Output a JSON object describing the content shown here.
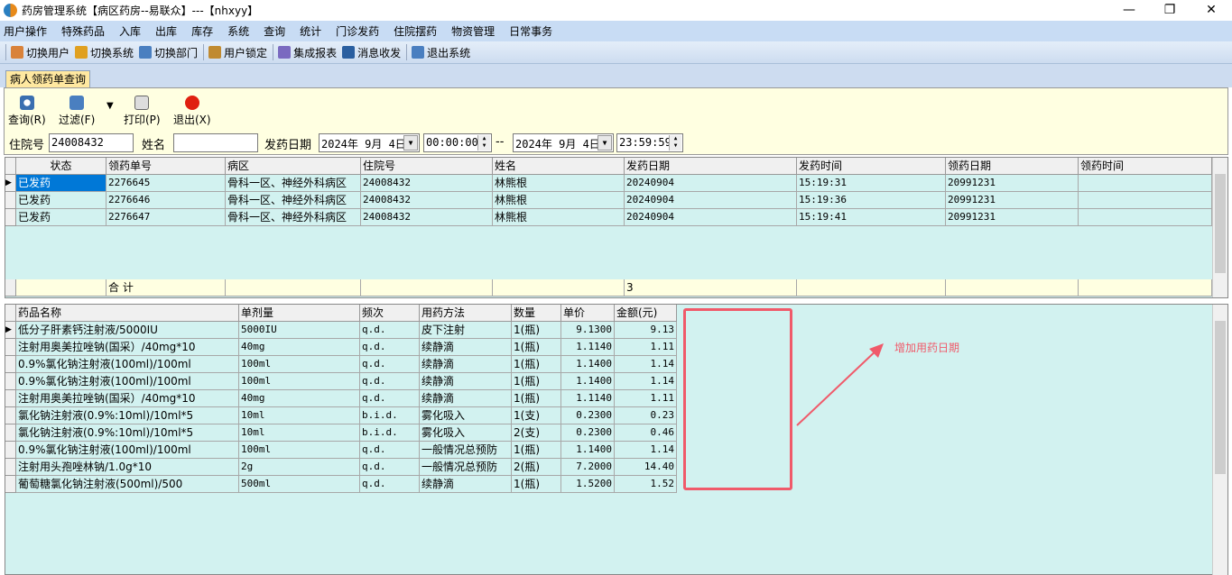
{
  "window": {
    "title": "药房管理系统【病区药房--易联众】---【nhxyy】",
    "minimize": "—",
    "maximize": "❐",
    "close": "✕"
  },
  "menu": [
    "用户操作",
    "特殊药品",
    "入库",
    "出库",
    "库存",
    "系统",
    "查询",
    "统计",
    "门诊发药",
    "住院摆药",
    "物资管理",
    "日常事务"
  ],
  "toolbar": [
    {
      "label": "切换用户",
      "icon": "switch-user-icon",
      "color": "#d9823a"
    },
    {
      "label": "切换系统",
      "icon": "switch-system-icon",
      "color": "#e0a020"
    },
    {
      "label": "切换部门",
      "icon": "switch-department-icon",
      "color": "#4a7fc0"
    },
    {
      "label": "用户锁定",
      "icon": "user-lock-icon",
      "color": "#c08a30"
    },
    {
      "label": "集成报表",
      "icon": "report-icon",
      "color": "#7a6ac0"
    },
    {
      "label": "消息收发",
      "icon": "message-icon",
      "color": "#2a5fa0"
    },
    {
      "label": "退出系统",
      "icon": "exit-system-icon",
      "color": "#4a7fc0"
    }
  ],
  "tab": "病人领药单查询",
  "actions": {
    "query": "查询(R)",
    "filter": "过滤(F)",
    "print": "打印(P)",
    "exit": "退出(X)"
  },
  "form": {
    "inpatient_label": "住院号",
    "inpatient_value": "24008432",
    "name_label": "姓名",
    "name_value": "",
    "date_label": "发药日期",
    "date_from": "2024年 9月 4日",
    "time_from": "00:00:00",
    "sep": "--",
    "date_to": "2024年 9月 4日",
    "time_to": "23:59:59"
  },
  "top_grid": {
    "columns": [
      "状态",
      "领药单号",
      "病区",
      "住院号",
      "姓名",
      "发药日期",
      "发药时间",
      "领药日期",
      "领药时间"
    ],
    "rows": [
      [
        "已发药",
        "2276645",
        "骨科一区、神经外科病区",
        "24008432",
        "林熊根",
        "20240904",
        "15:19:31",
        "20991231",
        ""
      ],
      [
        "已发药",
        "2276646",
        "骨科一区、神经外科病区",
        "24008432",
        "林熊根",
        "20240904",
        "15:19:36",
        "20991231",
        ""
      ],
      [
        "已发药",
        "2276647",
        "骨科一区、神经外科病区",
        "24008432",
        "林熊根",
        "20240904",
        "15:19:41",
        "20991231",
        ""
      ]
    ],
    "footer": {
      "label": "合 计",
      "count": "3"
    }
  },
  "bottom_grid": {
    "columns": [
      "药品名称",
      "单剂量",
      "频次",
      "用药方法",
      "数量",
      "单价",
      "金额(元)"
    ],
    "rows": [
      [
        "低分子肝素钙注射液/5000IU",
        "5000IU",
        "q.d.",
        "皮下注射",
        "1(瓶)",
        "9.1300",
        "9.13"
      ],
      [
        "注射用奥美拉唑钠(国采）/40mg*10",
        "40mg",
        "q.d.",
        "续静滴",
        "1(瓶)",
        "1.1140",
        "1.11"
      ],
      [
        "0.9%氯化钠注射液(100ml)/100ml",
        "100ml",
        "q.d.",
        "续静滴",
        "1(瓶)",
        "1.1400",
        "1.14"
      ],
      [
        "0.9%氯化钠注射液(100ml)/100ml",
        "100ml",
        "q.d.",
        "续静滴",
        "1(瓶)",
        "1.1400",
        "1.14"
      ],
      [
        "注射用奥美拉唑钠(国采）/40mg*10",
        "40mg",
        "q.d.",
        "续静滴",
        "1(瓶)",
        "1.1140",
        "1.11"
      ],
      [
        "氯化钠注射液(0.9%:10ml)/10ml*5",
        "10ml",
        "b.i.d.",
        "雾化吸入",
        "1(支)",
        "0.2300",
        "0.23"
      ],
      [
        "氯化钠注射液(0.9%:10ml)/10ml*5",
        "10ml",
        "b.i.d.",
        "雾化吸入",
        "2(支)",
        "0.2300",
        "0.46"
      ],
      [
        "0.9%氯化钠注射液(100ml)/100ml",
        "100ml",
        "q.d.",
        "一般情况总预防",
        "1(瓶)",
        "1.1400",
        "1.14"
      ],
      [
        "注射用头孢唑林钠/1.0g*10",
        "2g",
        "q.d.",
        "一般情况总预防",
        "2(瓶)",
        "7.2000",
        "14.40"
      ],
      [
        "葡萄糖氯化钠注射液(500ml)/500",
        "500ml",
        "q.d.",
        "续静滴",
        "1(瓶)",
        "1.5200",
        "1.52"
      ]
    ]
  },
  "annotation": {
    "text": "增加用药日期",
    "color": "#f05a6a"
  }
}
